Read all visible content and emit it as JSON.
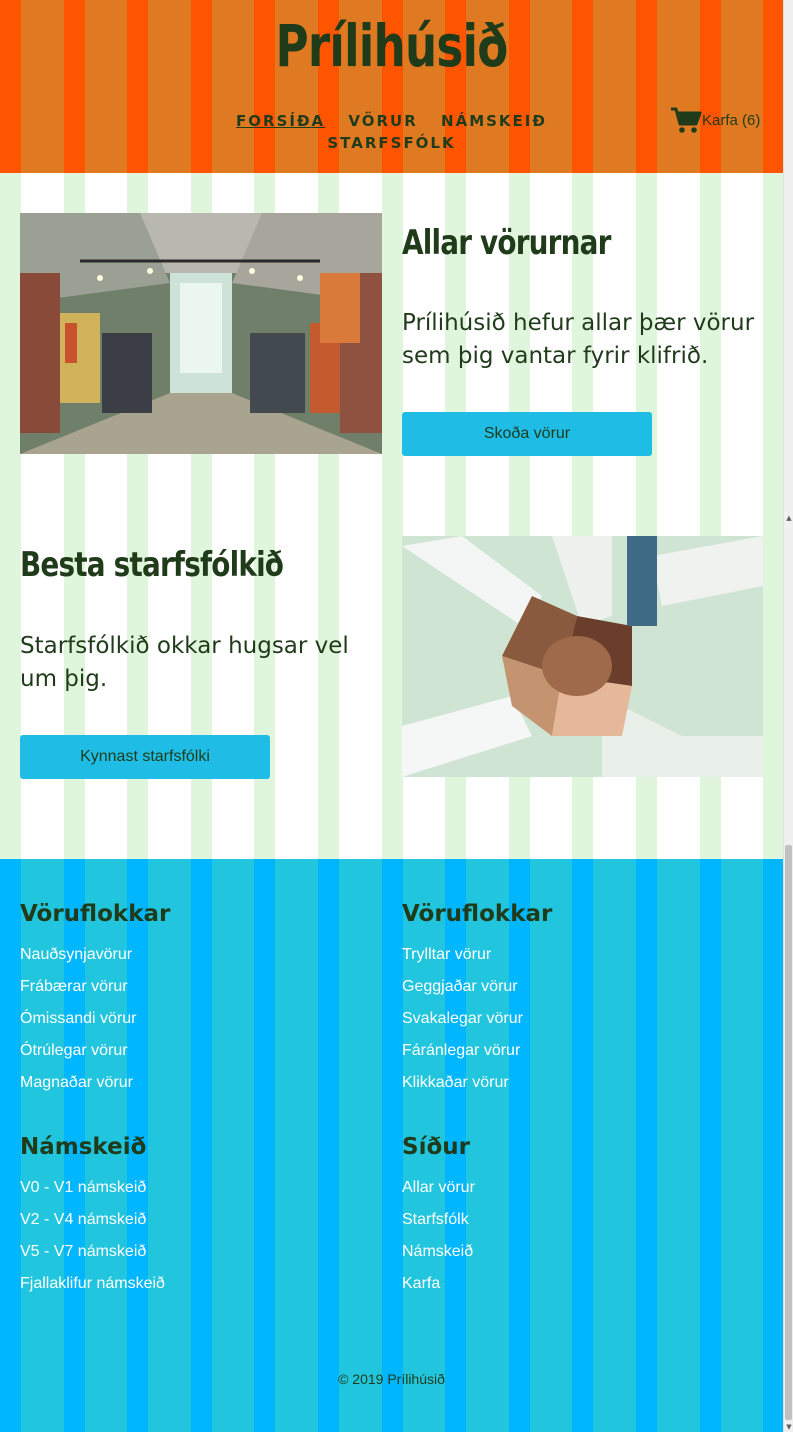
{
  "header": {
    "title": "Prílihúsið",
    "nav": [
      "FORSÍÐA",
      "VÖRUR",
      "NÁMSKEIÐ",
      "STARFSFÓLK"
    ],
    "active_nav": "FORSÍÐA",
    "cart_icon": "shopping-cart-icon",
    "cart_label": "Karfa (6)"
  },
  "features": [
    {
      "title": "Allar vörurnar",
      "text": "Prílihúsið hefur allar þær vörur sem þig vantar fyrir klifrið.",
      "button": "Skoða vörur",
      "image": "store-interior-photo"
    },
    {
      "title": "Besta starfsfólkið",
      "text": "Starfsfólkið okkar hugsar vel um þig.",
      "button": "Kynnast starfsfólki",
      "image": "joined-hands-photo"
    }
  ],
  "footer": {
    "columns": [
      {
        "heading": "Vöruflokkar",
        "items": [
          "Nauðsynjavörur",
          "Frábærar vörur",
          "Ómissandi vörur",
          "Ótrúlegar vörur",
          "Magnaðar vörur"
        ]
      },
      {
        "heading": "Vöruflokkar",
        "items": [
          "Trylltar vörur",
          "Geggjaðar vörur",
          "Svakalegar vörur",
          "Fáránlegar vörur",
          "Klikkaðar vörur"
        ]
      },
      {
        "heading": "Námskeið",
        "items": [
          "V0 - V1 námskeið",
          "V2 - V4 námskeið",
          "V5 - V7 námskeið",
          "Fjallaklifur námskeið"
        ]
      },
      {
        "heading": "Síður",
        "items": [
          "Allar vörur",
          "Starfsfólk",
          "Námskeið",
          "Karfa"
        ]
      }
    ],
    "copyright": "© 2019 Prílihúsið"
  },
  "colors": {
    "header_bg": "#e07a22",
    "header_stripe": "#ff5500",
    "main_stripe": "#e0f6dc",
    "button": "#1fbde6",
    "footer_bg": "#22c5de",
    "footer_stripe": "#00b6ff",
    "text_dark": "#1f3b1a"
  }
}
